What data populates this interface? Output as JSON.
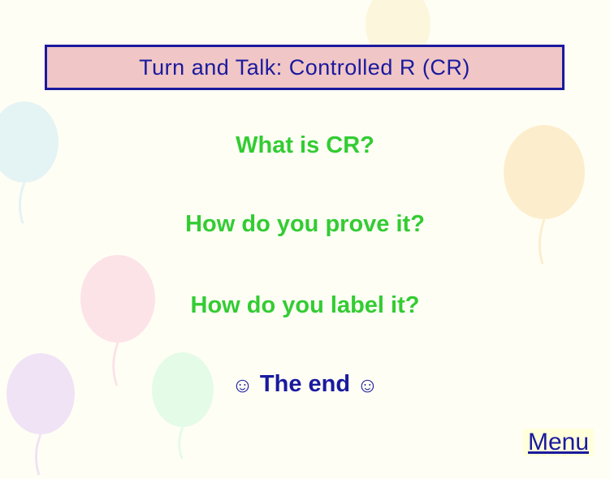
{
  "title": "Turn and Talk:  Controlled R  (CR)",
  "questions": [
    "What is CR?",
    "How do you prove it?",
    "How do you label it?"
  ],
  "end": {
    "text": " The end ",
    "smiley": "☺"
  },
  "menu_label": "Menu"
}
